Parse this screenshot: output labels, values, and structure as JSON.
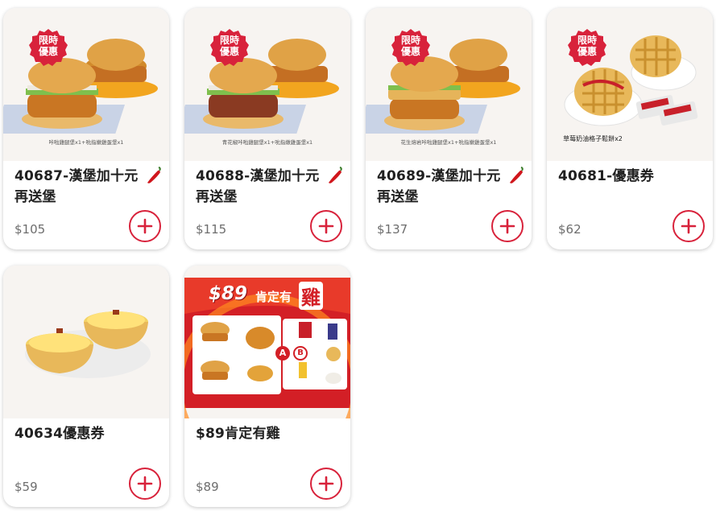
{
  "products": [
    {
      "title": "40687-漢堡加十元再送堡",
      "price": "$105",
      "badge": [
        "限時",
        "優惠"
      ],
      "caption": "咔啦雞腿堡x1+吮指嫩雞蛋堡x1",
      "spicy": true
    },
    {
      "title": "40688-漢堡加十元再送堡",
      "price": "$115",
      "badge": [
        "限時",
        "優惠"
      ],
      "caption": "青花椒咔啦雞腿堡x1+吮指嫩雞蛋堡x1",
      "spicy": true
    },
    {
      "title": "40689-漢堡加十元再送堡",
      "price": "$137",
      "badge": [
        "限時",
        "優惠"
      ],
      "caption": "花生熔岩咔啦雞腿堡x1+吮指嫩雞蛋堡x1",
      "spicy": true
    },
    {
      "title": "40681-優惠券",
      "price": "$62",
      "badge": [
        "限時",
        "優惠"
      ],
      "caption": "草莓奶油格子鬆餅x2",
      "spicy": false
    },
    {
      "title": "40634優惠券",
      "price": "$59",
      "spicy": false
    },
    {
      "title": "$89肯定有雞",
      "price": "$89",
      "promo_banner": {
        "price_text": "$89",
        "slogan": "肯定有",
        "highlight": "雞",
        "a_label": "A",
        "b_label": "B"
      },
      "spicy": false
    }
  ],
  "colors": {
    "accent": "#d8223b",
    "price": "#6d6d6d",
    "card_bg": "#ffffff",
    "image_bg": "#f7f4f1"
  }
}
